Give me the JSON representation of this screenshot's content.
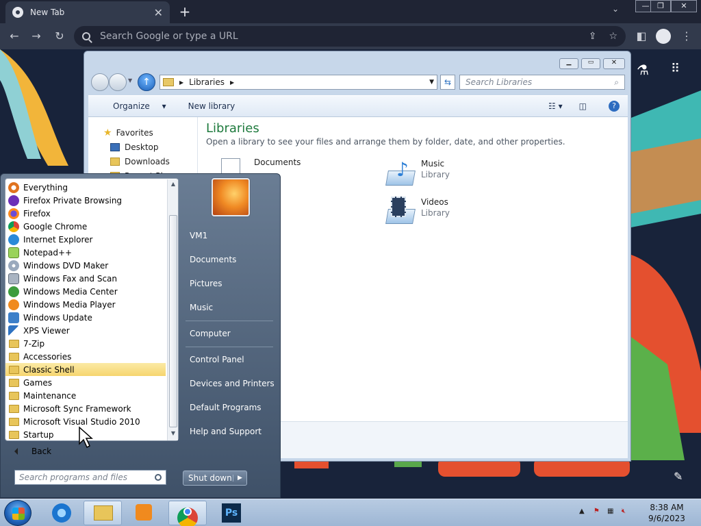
{
  "browser": {
    "tab_title": "New Tab",
    "omnibox_placeholder": "Search Google or type a URL"
  },
  "explorer": {
    "breadcrumb": "Libraries",
    "search_placeholder": "Search Libraries",
    "cmd": {
      "organize": "Organize",
      "new_library": "New library"
    },
    "nav": {
      "favorites": "Favorites",
      "items": [
        "Desktop",
        "Downloads",
        "Recent Places"
      ]
    },
    "title": "Libraries",
    "description": "Open a library to see your files and arrange them by folder, date, and other properties.",
    "libraries": [
      {
        "name": "Documents",
        "type": ""
      },
      {
        "name": "Music",
        "type": "Library"
      },
      {
        "name": "Videos",
        "type": "Library"
      }
    ]
  },
  "startmenu": {
    "programs": [
      "Everything",
      "Firefox Private Browsing",
      "Firefox",
      "Google Chrome",
      "Internet Explorer",
      "Notepad++",
      "Windows DVD Maker",
      "Windows Fax and Scan",
      "Windows Media Center",
      "Windows Media Player",
      "Windows Update",
      "XPS Viewer"
    ],
    "folders": [
      "7-Zip",
      "Accessories",
      "Classic Shell",
      "Games",
      "Maintenance",
      "Microsoft Sync Framework",
      "Microsoft Visual Studio 2010",
      "Startup"
    ],
    "selected_folder": "Classic Shell",
    "back": "Back",
    "search_placeholder": "Search programs and files",
    "links": [
      "VM1",
      "Documents",
      "Pictures",
      "Music",
      "Computer",
      "Control Panel",
      "Devices and Printers",
      "Default Programs",
      "Help and Support"
    ],
    "shutdown": "Shut down"
  },
  "taskbar": {
    "time": "8:38 AM",
    "date": "9/6/2023"
  },
  "colors": {
    "selection": "#f6d56f",
    "start_panel": "#4f6279",
    "lib_title": "#1e7a3d"
  }
}
